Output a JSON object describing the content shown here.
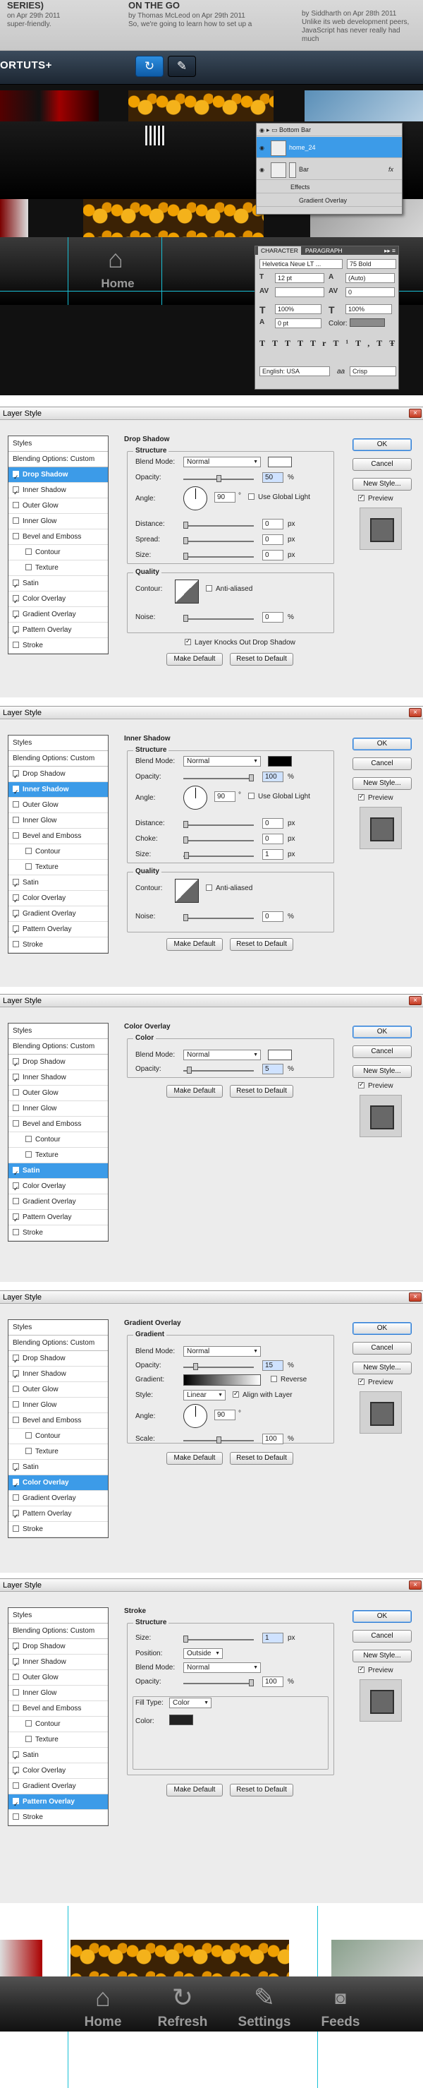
{
  "blog": {
    "posts": [
      {
        "title": "SERIES)",
        "meta": "on Apr 29th 2011",
        "desc": "super-friendly."
      },
      {
        "title": "ON THE GO",
        "meta": "by Thomas McLeod on Apr 29th 2011",
        "desc": "So, we're going to learn how to set up a"
      },
      {
        "title": "",
        "meta": "by Siddharth on Apr 28th 2011",
        "desc": "Unlike its web development peers, JavaScript has never really had much"
      }
    ],
    "brand": "ORTUTS+"
  },
  "home_label": "Home",
  "layers_panel": {
    "rows": [
      "Bottom Bar",
      "home_24",
      "Bar",
      "Effects",
      "Gradient Overlay"
    ],
    "fx": "fx"
  },
  "character_panel": {
    "tabs": [
      "CHARACTER",
      "PARAGRAPH"
    ],
    "font": "Helvetica Neue LT ...",
    "style": "75 Bold",
    "size": "12 pt",
    "leading": "(Auto)",
    "tracking": "0",
    "vscale": "100%",
    "hscale": "100%",
    "baseline": "0 pt",
    "color_label": "Color:",
    "type_buttons": [
      "T",
      "T",
      "TT",
      "Tr",
      "T¹",
      "T,",
      "T",
      "Ŧ"
    ],
    "language": "English: USA",
    "aa": "aa",
    "aa_mode": "Crisp"
  },
  "dialogs": [
    {
      "title": "Layer Style",
      "section": "Drop Shadow",
      "selected": 1,
      "checked": [
        1,
        2,
        8,
        9,
        10,
        11
      ],
      "subgroup": "Structure",
      "blend": "Normal",
      "color": "#ffffff",
      "opacity": "50",
      "angle": "90",
      "global_light": "Use Global Light",
      "distance": "0",
      "spread": "0",
      "size": "0",
      "quality": "Quality",
      "noise": "0",
      "knockout": "Layer Knocks Out Drop Shadow"
    },
    {
      "title": "Layer Style",
      "section": "Inner Shadow",
      "selected": 2,
      "checked": [
        1,
        2,
        8,
        9,
        10,
        11
      ],
      "subgroup": "Structure",
      "blend": "Normal",
      "color": "#000000",
      "opacity": "100",
      "angle": "90",
      "global_light": "Use Global Light",
      "distance": "0",
      "choke": "0",
      "size": "1",
      "quality": "Quality",
      "noise": "0"
    },
    {
      "title": "Layer Style",
      "section": "Color Overlay",
      "selected": 8,
      "checked": [
        1,
        2,
        8,
        9,
        11
      ],
      "subgroup": "Color",
      "blend": "Normal",
      "color": "#ffffff",
      "opacity": "5"
    },
    {
      "title": "Layer Style",
      "section": "Gradient Overlay",
      "selected": 9,
      "checked": [
        1,
        2,
        8,
        9,
        11
      ],
      "subgroup": "Gradient",
      "blend": "Normal",
      "opacity": "15",
      "reverse": "Reverse",
      "style": "Linear",
      "align": "Align with Layer",
      "angle": "90",
      "scale": "100"
    },
    {
      "title": "Layer Style",
      "section": "Stroke",
      "selected": 11,
      "checked": [
        1,
        2,
        8,
        9,
        11
      ],
      "subgroup": "Structure",
      "size": "1",
      "position": "Outside",
      "blend": "Normal",
      "opacity": "100",
      "fill_type": "Color",
      "color": "#222222"
    }
  ],
  "style_items": [
    "Styles",
    "Blending Options: Custom",
    "Drop Shadow",
    "Inner Shadow",
    "Outer Glow",
    "Inner Glow",
    "Bevel and Emboss",
    "Contour",
    "Texture",
    "Satin",
    "Color Overlay",
    "Gradient Overlay",
    "Pattern Overlay",
    "Stroke"
  ],
  "labels": {
    "blend_mode": "Blend Mode:",
    "opacity": "Opacity:",
    "angle": "Angle:",
    "distance": "Distance:",
    "spread": "Spread:",
    "choke": "Choke:",
    "size": "Size:",
    "contour": "Contour:",
    "anti_aliased": "Anti-aliased",
    "noise": "Noise:",
    "percent": "%",
    "px": "px",
    "deg": "°",
    "gradient": "Gradient:",
    "style": "Style:",
    "scale": "Scale:",
    "position": "Position:",
    "fill_type": "Fill Type:",
    "color": "Color:"
  },
  "buttons": {
    "ok": "OK",
    "cancel": "Cancel",
    "new_style": "New Style...",
    "preview": "Preview",
    "make_default": "Make Default",
    "reset_default": "Reset to Default"
  },
  "tabbar": [
    {
      "label": "Home",
      "icon": "house-icon"
    },
    {
      "label": "Refresh",
      "icon": "refresh-icon"
    },
    {
      "label": "Settings",
      "icon": "wrench-icon"
    },
    {
      "label": "Feeds",
      "icon": "rss-icon"
    }
  ]
}
